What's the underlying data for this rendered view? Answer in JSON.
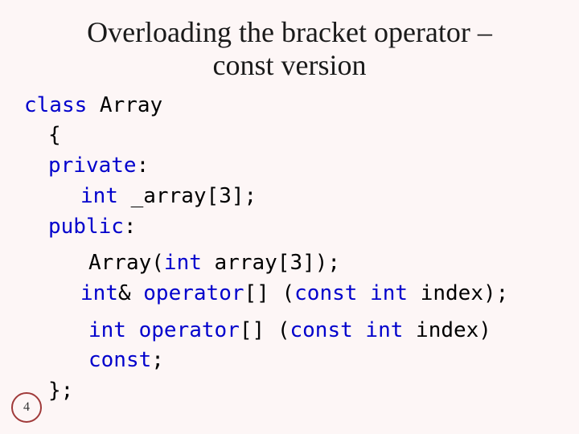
{
  "title_line1": "Overloading the bracket operator –",
  "title_line2": "const version",
  "page_number": "4",
  "code": {
    "kw_class": "class",
    "class_name": " Array",
    "lbrace": "{",
    "kw_private": "private",
    "colon1": ":",
    "kw_int1": "int",
    "arr_decl": " _array[3];",
    "kw_public": "public",
    "colon2": ":",
    "ctor_pre": "Array(",
    "kw_int2": "int",
    "ctor_post": " array[3]);",
    "kw_int3": "int",
    "amp": "& ",
    "kw_op1": "operator",
    "op1_mid": "[] (",
    "kw_const1": "const",
    "sp1": " ",
    "kw_int4": "int",
    "op1_post": " index);",
    "kw_int5": "int",
    "sp2": " ",
    "kw_op2": "operator",
    "op2_mid": "[] (",
    "kw_const2": "const",
    "sp3": " ",
    "kw_int6": "int",
    "op2_post1": " index) ",
    "kw_const3": "const",
    "op2_post2": ";",
    "rbrace": "};"
  }
}
